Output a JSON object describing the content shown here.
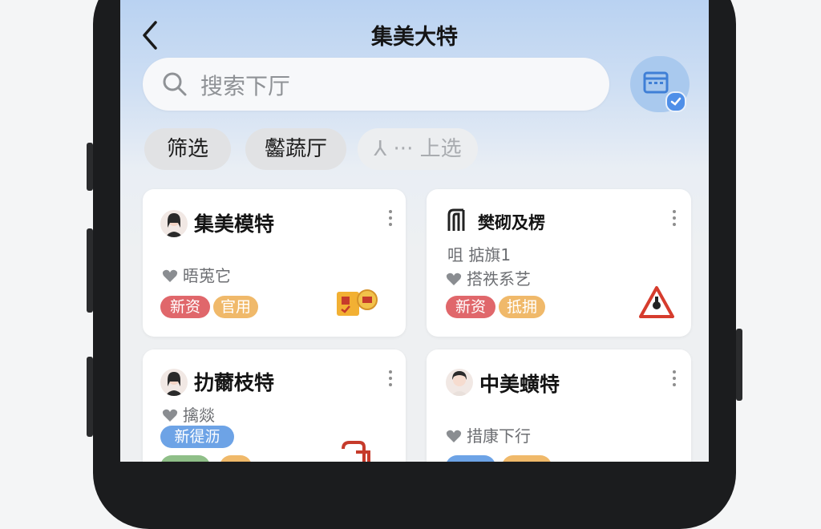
{
  "header": {
    "title": "集美大特"
  },
  "search": {
    "placeholder": "搜索下厅"
  },
  "filters": [
    {
      "label": "筛选"
    },
    {
      "label": "齾蔬厅"
    },
    {
      "label": "⅄ ··· 上选"
    }
  ],
  "cards": [
    {
      "name": "集美模特",
      "info1": "",
      "info2": "晤莵它",
      "tags": [
        "新资",
        "官用"
      ],
      "badge_icon": "stamp-badge-icon"
    },
    {
      "name": "樊砌及楞",
      "info1": "咀 掂旗1",
      "info2": "搭祑系艺",
      "tags": [
        "新资",
        "抵拥"
      ],
      "badge_icon": "warning-triangle-icon"
    },
    {
      "name": "扐薾枝特",
      "info1": "",
      "info2": "擒燚",
      "tags": [
        "新徥沥"
      ],
      "badge_icon": "hook-icon"
    },
    {
      "name": "中美蟥特",
      "info1": "",
      "info2": "措康下行",
      "tags": [],
      "badge_icon": ""
    }
  ],
  "colors": {
    "tag_red": "#e0676b",
    "tag_orange": "#f0b96a",
    "tag_blue": "#6da3e6",
    "accent": "#4f8fe8"
  }
}
